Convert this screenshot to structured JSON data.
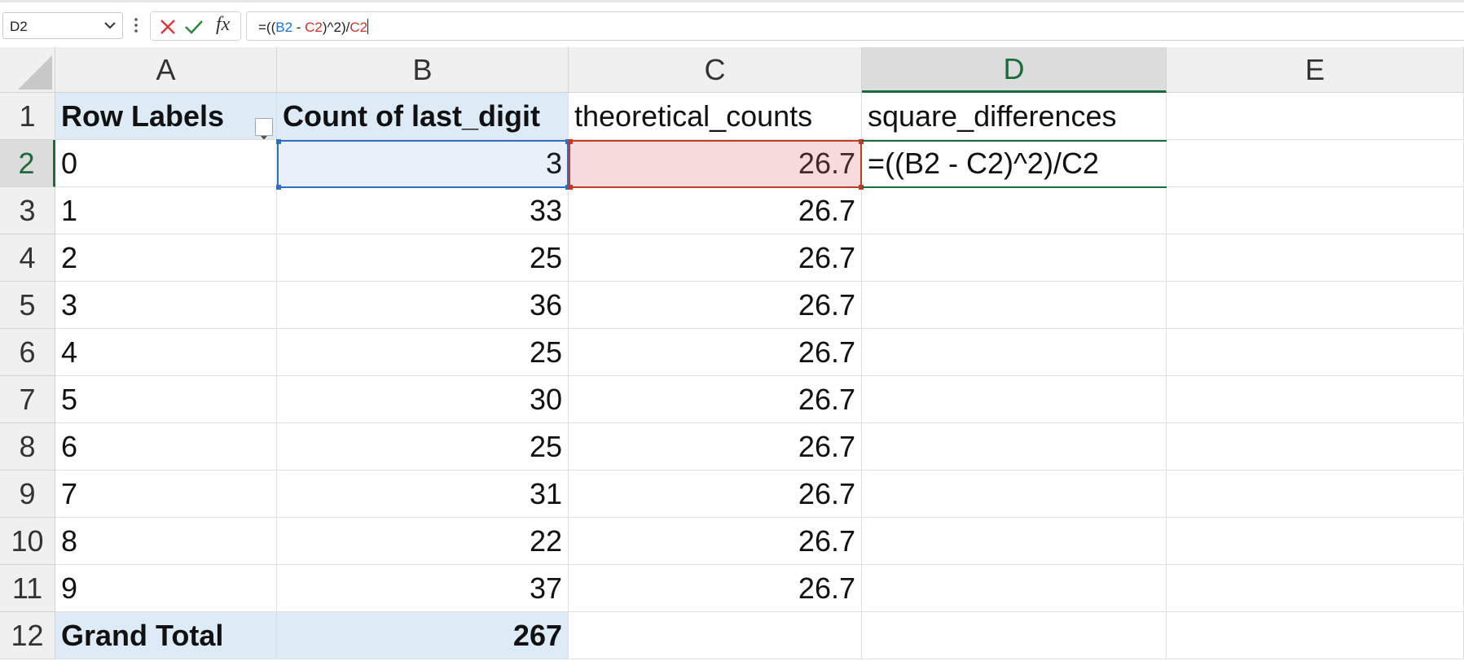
{
  "formula_bar": {
    "name_box": "D2",
    "formula_parts": [
      {
        "text": "=((",
        "kind": "plain"
      },
      {
        "text": "B2",
        "kind": "ref-b"
      },
      {
        "text": " - ",
        "kind": "plain"
      },
      {
        "text": "C2",
        "kind": "ref-c"
      },
      {
        "text": ")^2)/",
        "kind": "plain"
      },
      {
        "text": "C2",
        "kind": "ref-c"
      }
    ],
    "fx_label": "fx"
  },
  "sheet": {
    "columns": [
      "A",
      "B",
      "C",
      "D",
      "E"
    ],
    "active_column": "D",
    "active_row": "2",
    "rows": [
      {
        "num": "1",
        "cells": [
          "Row Labels",
          "Count of last_digit",
          "theoretical_counts",
          "square_differences",
          ""
        ]
      },
      {
        "num": "2",
        "cells": [
          "0",
          "3",
          "26.7",
          "=((B2 - C2)^2)/C2",
          ""
        ]
      },
      {
        "num": "3",
        "cells": [
          "1",
          "33",
          "26.7",
          "",
          ""
        ]
      },
      {
        "num": "4",
        "cells": [
          "2",
          "25",
          "26.7",
          "",
          ""
        ]
      },
      {
        "num": "5",
        "cells": [
          "3",
          "36",
          "26.7",
          "",
          ""
        ]
      },
      {
        "num": "6",
        "cells": [
          "4",
          "25",
          "26.7",
          "",
          ""
        ]
      },
      {
        "num": "7",
        "cells": [
          "5",
          "30",
          "26.7",
          "",
          ""
        ]
      },
      {
        "num": "8",
        "cells": [
          "6",
          "25",
          "26.7",
          "",
          ""
        ]
      },
      {
        "num": "9",
        "cells": [
          "7",
          "31",
          "26.7",
          "",
          ""
        ]
      },
      {
        "num": "10",
        "cells": [
          "8",
          "22",
          "26.7",
          "",
          ""
        ]
      },
      {
        "num": "11",
        "cells": [
          "9",
          "37",
          "26.7",
          "",
          ""
        ]
      },
      {
        "num": "12",
        "cells": [
          "Grand Total",
          "267",
          "",
          "",
          ""
        ]
      }
    ]
  },
  "colors": {
    "pivot_fill": "#ddebf7",
    "ref_b": "#1f6fd1",
    "ref_c": "#c0392b",
    "active_header": "#1c6b3a"
  }
}
